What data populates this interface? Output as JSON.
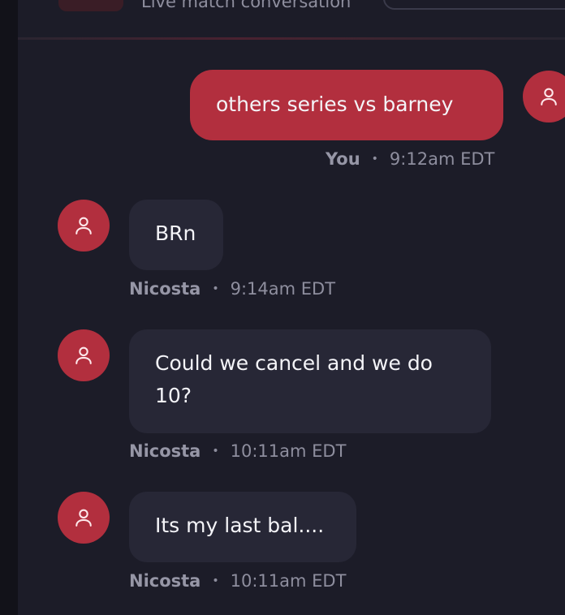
{
  "header": {
    "subtitle": "Live match conversation"
  },
  "messages": [
    {
      "author": "You",
      "time": "9:12am EDT",
      "text": "others series vs barney",
      "own": true
    },
    {
      "author": "Nicosta",
      "time": "9:14am EDT",
      "text": "BRn",
      "own": false
    },
    {
      "author": "Nicosta",
      "time": "10:11am EDT",
      "text": "Could we cancel and we do 10?",
      "own": false
    },
    {
      "author": "Nicosta",
      "time": "10:11am EDT",
      "text": "Its my last bal....",
      "own": false
    }
  ],
  "meta": {
    "separator": "•"
  },
  "colors": {
    "accent": "#b22f3e",
    "background": "#1c1c28",
    "bubble_other": "#272736",
    "meta_text": "#8e8e9e"
  },
  "icons": {
    "avatar": "user-icon"
  }
}
